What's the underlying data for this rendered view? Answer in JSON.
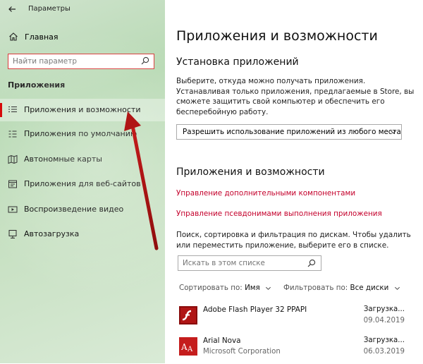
{
  "window": {
    "title": "Параметры"
  },
  "sidebar": {
    "home_label": "Главная",
    "search_placeholder": "Найти параметр",
    "section_header": "Приложения",
    "items": [
      {
        "label": "Приложения и возможности",
        "icon": "apps-list-icon",
        "active": true
      },
      {
        "label": "Приложения по умолчанию",
        "icon": "default-apps-icon"
      },
      {
        "label": "Автономные карты",
        "icon": "offline-maps-icon"
      },
      {
        "label": "Приложения для веб-сайтов",
        "icon": "web-apps-icon"
      },
      {
        "label": "Воспроизведение видео",
        "icon": "video-playback-icon"
      },
      {
        "label": "Автозагрузка",
        "icon": "startup-icon"
      }
    ]
  },
  "main": {
    "title": "Приложения и возможности",
    "install": {
      "heading": "Установка приложений",
      "description": "Выберите, откуда можно получать приложения. Устанавливая только приложения, предлагаемые в Store, вы сможете защитить свой компьютер и обеспечить его бесперебойную работу.",
      "dropdown_value": "Разрешить использование приложений из любого места"
    },
    "apps": {
      "heading": "Приложения и возможности",
      "link_optional": "Управление дополнительными компонентами",
      "link_aliases": "Управление псевдонимами выполнения приложения",
      "description": "Поиск, сортировка и фильтрация по дискам. Чтобы удалить или переместить приложение, выберите его в списке.",
      "search_placeholder": "Искать в этом списке",
      "sort_label": "Сортировать по:",
      "sort_value": "Имя",
      "filter_label": "Фильтровать по:",
      "filter_value": "Все диски",
      "list": [
        {
          "name": "Adobe Flash Player 32 PPAPI",
          "publisher": "",
          "size": "Загрузка...",
          "date": "09.04.2019",
          "icon": "flash-player-icon"
        },
        {
          "name": "Arial Nova",
          "publisher": "Microsoft Corporation",
          "size": "Загрузка...",
          "date": "06.03.2019",
          "icon": "font-app-icon"
        }
      ]
    }
  },
  "colors": {
    "accent": "#d40000",
    "link": "#c4002b",
    "search_border": "#d83a3a"
  }
}
